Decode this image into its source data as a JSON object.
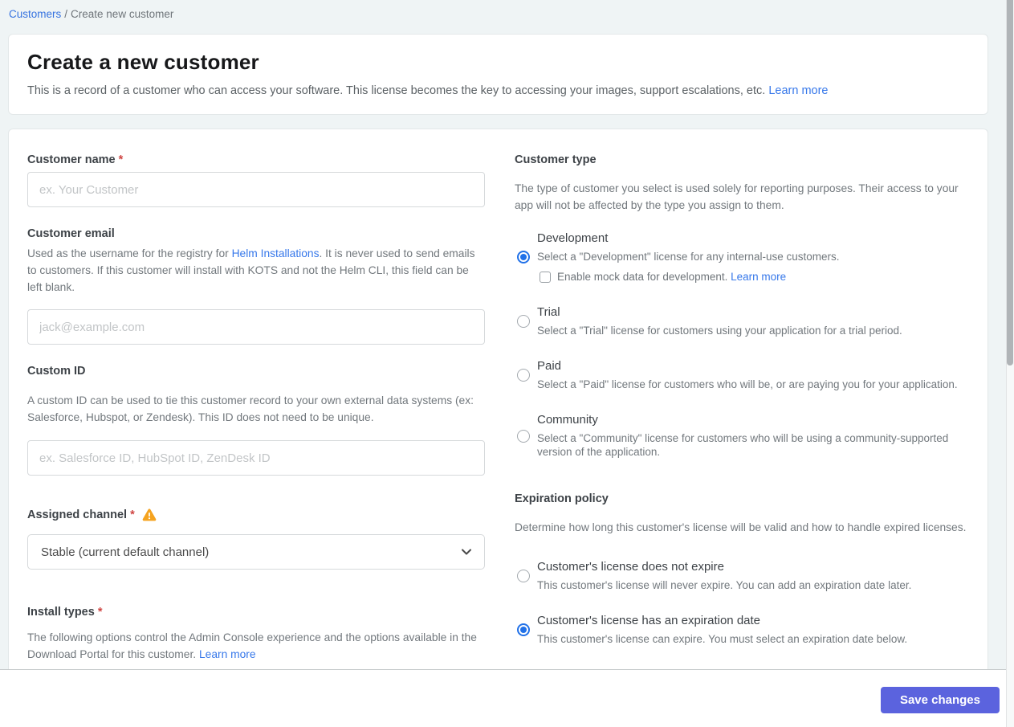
{
  "breadcrumb": {
    "link": "Customers",
    "separator": "/",
    "current": "Create new customer"
  },
  "header": {
    "title": "Create a new customer",
    "description": "This is a record of a customer who can access your software. This license becomes the key to accessing your images, support escalations, etc.",
    "learn_more": "Learn more"
  },
  "form": {
    "customer_name": {
      "label": "Customer name",
      "required": "*",
      "placeholder": "ex. Your Customer",
      "value": ""
    },
    "customer_email": {
      "label": "Customer email",
      "description_pre": "Used as the username for the registry for ",
      "description_link": "Helm Installations",
      "description_post": ". It is never used to send emails to customers. If this customer will install with KOTS and not the Helm CLI, this field can be left blank.",
      "placeholder": "jack@example.com",
      "value": ""
    },
    "custom_id": {
      "label": "Custom ID",
      "description": "A custom ID can be used to tie this customer record to your own external data systems (ex: Salesforce, Hubspot, or Zendesk). This ID does not need to be unique.",
      "placeholder": "ex. Salesforce ID, HubSpot ID, ZenDesk ID",
      "value": ""
    },
    "assigned_channel": {
      "label": "Assigned channel",
      "required": "*",
      "selected_option": "Stable (current default channel)"
    },
    "install_types": {
      "label": "Install types",
      "required": "*",
      "description": "The following options control the Admin Console experience and the options available in the Download Portal for this customer.",
      "learn_more": "Learn more"
    }
  },
  "customer_type": {
    "heading": "Customer type",
    "description": "The type of customer you select is used solely for reporting purposes. Their access to your app will not be affected by the type you assign to them.",
    "options": [
      {
        "label": "Development",
        "description": "Select a \"Development\" license for any internal-use customers.",
        "selected": true,
        "checkbox": {
          "label": "Enable mock data for development.",
          "learn_more": "Learn more",
          "checked": false
        }
      },
      {
        "label": "Trial",
        "description": "Select a \"Trial\" license for customers using your application for a trial period.",
        "selected": false
      },
      {
        "label": "Paid",
        "description": "Select a \"Paid\" license for customers who will be, or are paying you for your application.",
        "selected": false
      },
      {
        "label": "Community",
        "description": "Select a \"Community\" license for customers who will be using a community-supported version of the application.",
        "selected": false
      }
    ]
  },
  "expiration_policy": {
    "heading": "Expiration policy",
    "description": "Determine how long this customer's license will be valid and how to handle expired licenses.",
    "options": [
      {
        "label": "Customer's license does not expire",
        "description": "This customer's license will never expire. You can add an expiration date later.",
        "selected": false
      },
      {
        "label": "Customer's license has an expiration date",
        "description": "This customer's license can expire. You must select an expiration date below.",
        "selected": true
      }
    ]
  },
  "footer": {
    "save_label": "Save changes"
  },
  "colors": {
    "link_blue": "#3778ea",
    "breadcrumb_link": "#3673e0",
    "radio_selected": "#2171e8",
    "save_button": "#5b63de",
    "warning_amber": "#f5a31f",
    "required_red": "#cf4542",
    "page_background": "#eff4f5"
  }
}
